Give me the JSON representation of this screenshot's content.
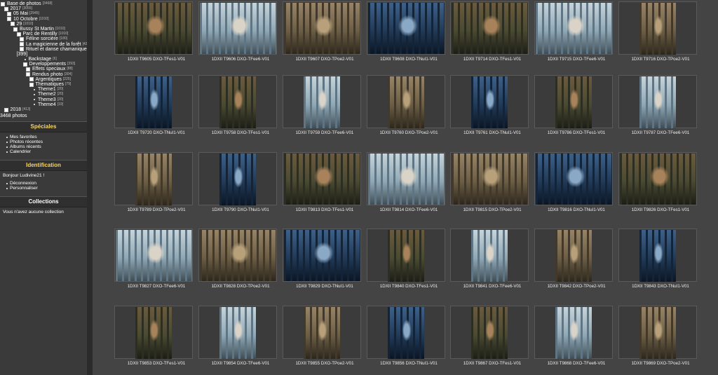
{
  "sidebar": {
    "tree": [
      {
        "label": "Base de photos",
        "count": "[3468]",
        "level": 0,
        "kind": "exp"
      },
      {
        "label": "2017",
        "count": "[3055]",
        "level": 1,
        "kind": "exp"
      },
      {
        "label": "05 Mai",
        "count": "[2945]",
        "level": 2,
        "kind": "exp"
      },
      {
        "label": "10 Octobre",
        "count": "[1010]",
        "level": 2,
        "kind": "exp"
      },
      {
        "label": "29",
        "count": "[1010]",
        "level": 3,
        "kind": "exp"
      },
      {
        "label": "Bussy St Martin",
        "count": "[1010]",
        "level": 4,
        "kind": "exp"
      },
      {
        "label": "Parc de Rentilly",
        "count": "[1010]",
        "level": 5,
        "kind": "exp"
      },
      {
        "label": "Féline sorcière",
        "count": "[180]",
        "level": 6,
        "kind": "exp"
      },
      {
        "label": "La magicienne de la forêt",
        "count": "[423]",
        "level": 6,
        "kind": "exp"
      },
      {
        "label": "Rituel et danse chamanique",
        "count": "",
        "level": 6,
        "kind": "exp"
      },
      {
        "label": "[399]",
        "count": "",
        "level": 5,
        "kind": "none"
      },
      {
        "label": "Backstage",
        "count": "[6]",
        "level": 7,
        "kind": "dot"
      },
      {
        "label": "Developpements",
        "count": "[393]",
        "level": 7,
        "kind": "exp"
      },
      {
        "label": "Effets speciaux",
        "count": "[88]",
        "level": 8,
        "kind": "exp"
      },
      {
        "label": "Rendus photo",
        "count": "[304]",
        "level": 8,
        "kind": "exp"
      },
      {
        "label": "Argentiques",
        "count": "[225]",
        "level": 9,
        "kind": "exp"
      },
      {
        "label": "Thematiques",
        "count": "[79]",
        "level": 9,
        "kind": "exp"
      },
      {
        "label": "Theme1",
        "count": "[20]",
        "level": 10,
        "kind": "dot"
      },
      {
        "label": "Theme2",
        "count": "[20]",
        "level": 10,
        "kind": "dot"
      },
      {
        "label": "Theme3",
        "count": "[20]",
        "level": 10,
        "kind": "dot"
      },
      {
        "label": "Theme4",
        "count": "[19]",
        "level": 10,
        "kind": "dot"
      },
      {
        "label": "2018",
        "count": "[413]",
        "level": 1,
        "kind": "exp"
      }
    ],
    "photo_count": "3468 photos",
    "specials": {
      "title": "Spéciales",
      "items": [
        "Mes favorites",
        "Photos récentes",
        "Albums récents",
        "Calendrier"
      ]
    },
    "identification": {
      "title": "Identification",
      "greeting": "Bonjour Ludivine21 !",
      "items": [
        "Déconnexion",
        "Personnaliser"
      ]
    },
    "collections": {
      "title": "Collections",
      "empty_text": "Vous n'avez aucune collection"
    }
  },
  "colors": {
    "accent_yellow": "#f5d66a",
    "background": "#444444",
    "sidebar": "#3a3a3a"
  },
  "thumbnails": [
    {
      "caption": "1DXII T9605 DXO-TFes1-V01",
      "orientation": "landscape",
      "tone": "warm"
    },
    {
      "caption": "1DXII T9606 DXO-TFee6-V01",
      "orientation": "landscape",
      "tone": "pale"
    },
    {
      "caption": "1DXII T9607 DXO-TPoe2-V01",
      "orientation": "landscape",
      "tone": "sepia"
    },
    {
      "caption": "1DXII T9608 DXO-TNuI1-V01",
      "orientation": "landscape",
      "tone": "blue"
    },
    {
      "caption": "1DXII T9714 DXO-TFes1-V01",
      "orientation": "landscape",
      "tone": "warm"
    },
    {
      "caption": "1DXII T9715 DXO-TFee6-V01",
      "orientation": "landscape",
      "tone": "pale"
    },
    {
      "caption": "1DXII T9716 DXO-TPoe2-V01",
      "orientation": "portrait",
      "tone": "sepia"
    },
    {
      "caption": "1DXII T9720 DXO-TNuI1-V01",
      "orientation": "portrait",
      "tone": "blue"
    },
    {
      "caption": "1DXII T9758 DXO-TFes1-V01",
      "orientation": "portrait",
      "tone": "warm"
    },
    {
      "caption": "1DXII T9759 DXO-TFee6-V01",
      "orientation": "portrait",
      "tone": "pale"
    },
    {
      "caption": "1DXII T9760 DXO-TPoe2-V01",
      "orientation": "portrait",
      "tone": "sepia"
    },
    {
      "caption": "1DXII T9761 DXO-TNuI1-V01",
      "orientation": "portrait",
      "tone": "blue"
    },
    {
      "caption": "1DXII T9786 DXO-TFes1-V01",
      "orientation": "portrait",
      "tone": "warm"
    },
    {
      "caption": "1DXII T9787 DXO-TFee6-V01",
      "orientation": "portrait",
      "tone": "pale"
    },
    {
      "caption": "1DXII T9789 DXO-TPoe2-V01",
      "orientation": "portrait",
      "tone": "sepia"
    },
    {
      "caption": "1DXII T9790 DXO-TNuI1-V01",
      "orientation": "portrait",
      "tone": "blue"
    },
    {
      "caption": "1DXII T9813 DXO-TFes1-V01",
      "orientation": "landscape",
      "tone": "warm"
    },
    {
      "caption": "1DXII T9814 DXO-TFee6-V01",
      "orientation": "landscape",
      "tone": "pale"
    },
    {
      "caption": "1DXII T9815 DXO-TPoe2-V01",
      "orientation": "landscape",
      "tone": "sepia"
    },
    {
      "caption": "1DXII T9816 DXO-TNuI1-V01",
      "orientation": "landscape",
      "tone": "blue"
    },
    {
      "caption": "1DXII T9826 DXO-TFes1-V01",
      "orientation": "landscape",
      "tone": "warm"
    },
    {
      "caption": "1DXII T9827 DXO-TFee6-V01",
      "orientation": "landscape",
      "tone": "pale"
    },
    {
      "caption": "1DXII T9828 DXO-TPoe2-V01",
      "orientation": "landscape",
      "tone": "sepia"
    },
    {
      "caption": "1DXII T9829 DXO-TNuI1-V01",
      "orientation": "landscape",
      "tone": "blue"
    },
    {
      "caption": "1DXII T9840 DXO-TFes1-V01",
      "orientation": "portrait",
      "tone": "warm"
    },
    {
      "caption": "1DXII T9841 DXO-TFee6-V01",
      "orientation": "portrait",
      "tone": "pale"
    },
    {
      "caption": "1DXII T9842 DXO-TPoe2-V01",
      "orientation": "portrait",
      "tone": "sepia"
    },
    {
      "caption": "1DXII T9843 DXO-TNuI1-V01",
      "orientation": "portrait",
      "tone": "blue"
    },
    {
      "caption": "1DXII T9853 DXO-TFes1-V01",
      "orientation": "portrait",
      "tone": "warm"
    },
    {
      "caption": "1DXII T9854 DXO-TFee6-V01",
      "orientation": "portrait",
      "tone": "pale"
    },
    {
      "caption": "1DXII T9855 DXO-TPoe2-V01",
      "orientation": "portrait",
      "tone": "sepia"
    },
    {
      "caption": "1DXII T9856 DXO-TNuI1-V01",
      "orientation": "portrait",
      "tone": "blue"
    },
    {
      "caption": "1DXII T9867 DXO-TFes1-V01",
      "orientation": "portrait",
      "tone": "warm"
    },
    {
      "caption": "1DXII T9868 DXO-TFee6-V01",
      "orientation": "portrait",
      "tone": "pale"
    },
    {
      "caption": "1DXII T9869 DXO-TPoe2-V01",
      "orientation": "portrait",
      "tone": "sepia"
    }
  ]
}
